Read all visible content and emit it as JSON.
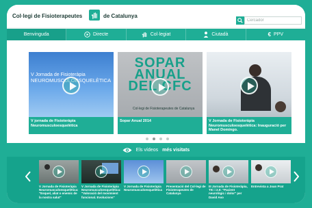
{
  "header": {
    "logo_left_text": "Col·legi de Fisioterapeutes",
    "logo_right_text": "de Catalunya",
    "logo_icon": "hand-icon"
  },
  "search": {
    "placeholder": "Cercador",
    "icon": "search-icon"
  },
  "nav": {
    "items": [
      {
        "label": "Benvinguda",
        "icon": ""
      },
      {
        "label": "Directe",
        "icon": "play-circle-icon"
      },
      {
        "label": "Col·legiat",
        "icon": "hand-icon"
      },
      {
        "label": "Ciutadà",
        "icon": "person-icon"
      },
      {
        "label": "PPV",
        "icon": "euro-icon"
      }
    ]
  },
  "featured": [
    {
      "thumb_text_line1": "V Jornada de Fisioteràpia",
      "thumb_text_line2": "NEUROMUSCULOESQUELÈTICA",
      "caption": "V jornada de Fisioteràpia Neuromusculoesquelètica"
    },
    {
      "thumb_title_lines": [
        "SOPAR",
        "ANUAL",
        "DEL CFC"
      ],
      "thumb_footer": "Col·legi de Fisioterapeutes de Catalunya",
      "caption": "Sopar Anual 2014"
    },
    {
      "caption": "V Jornada de Fisioteràpia Neuromusculoesquelètica: Inauguració per Manel Domingo."
    }
  ],
  "carousel": {
    "dots": 4,
    "active_index": 1
  },
  "most_viewed": {
    "prefix": "Els vídeos",
    "bold": "més visitats",
    "icon": "eye-icon"
  },
  "videos": [
    {
      "caption": "V Jornada de Fisioteràpia Neuromusculoesquelètica: \"Esquel, aliat o enemic de la nostra salut\""
    },
    {
      "caption": "V Jornada de Fisioteràpia Neuromusculoesquelètica: \"Valoració del movimient funcional. Evolucions\""
    },
    {
      "caption": "V Jornada de Fisioteràpia Neuromusculoesquelètica"
    },
    {
      "caption": "Presentació del Col·legi de Fisioterapeutes de Catalunya"
    },
    {
      "caption": "III Jornada de Fisioteràpia, TIC i 2.0: \"Pacient neurològic i dolor\" per David Aso"
    },
    {
      "caption": "Entrevista a Joan Prat"
    }
  ],
  "colors": {
    "brand": "#1fae96",
    "strip": "#15a38c",
    "frame_bg": "#eef3f1"
  }
}
